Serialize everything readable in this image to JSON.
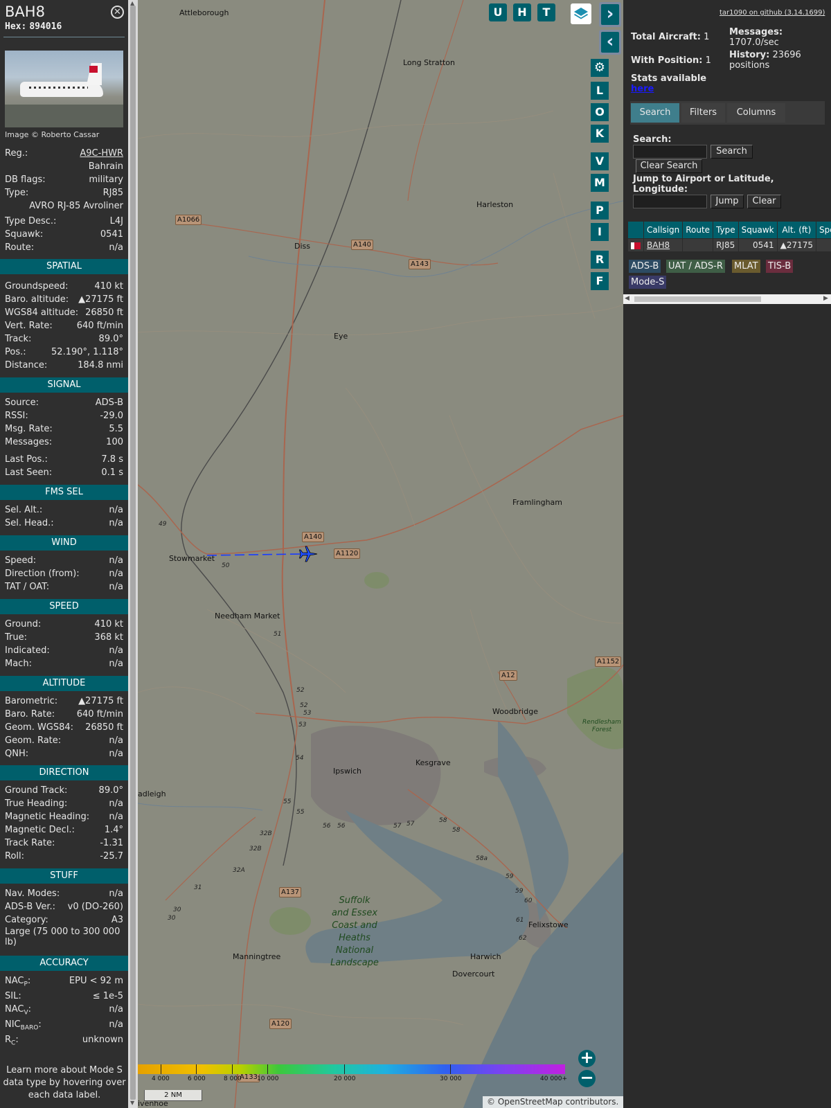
{
  "aircraft": {
    "callsign": "BAH8",
    "hex_label": "Hex:",
    "hex": "894016",
    "image_credit": "Image © Roberto Cassar",
    "fields": {
      "reg_label": "Reg.:",
      "reg": "A9C-HWR",
      "country": "Bahrain",
      "dbflags_label": "DB flags:",
      "dbflags": "military",
      "type_label": "Type:",
      "type": "RJ85",
      "type_name": "AVRO RJ-85 Avroliner",
      "typedesc_label": "Type Desc.:",
      "typedesc": "L4J",
      "squawk_label": "Squawk:",
      "squawk": "0541",
      "route_label": "Route:",
      "route": "n/a"
    }
  },
  "sections": {
    "spatial": {
      "title": "SPATIAL",
      "rows": [
        {
          "l": "Groundspeed:",
          "v": "410 kt"
        },
        {
          "l": "Baro. altitude:",
          "v": "▲27175 ft"
        },
        {
          "l": "WGS84 altitude:",
          "v": "26850 ft"
        },
        {
          "l": "Vert. Rate:",
          "v": "640 ft/min"
        },
        {
          "l": "Track:",
          "v": "89.0°"
        },
        {
          "l": "Pos.:",
          "v": "52.190°, 1.118°"
        },
        {
          "l": "Distance:",
          "v": "184.8 nmi"
        }
      ]
    },
    "signal": {
      "title": "SIGNAL",
      "rows": [
        {
          "l": "Source:",
          "v": "ADS-B"
        },
        {
          "l": "RSSI:",
          "v": "-29.0"
        },
        {
          "l": "Msg. Rate:",
          "v": "5.5"
        },
        {
          "l": "Messages:",
          "v": "100"
        },
        {
          "l": "Last Pos.:",
          "v": "7.8 s"
        },
        {
          "l": "Last Seen:",
          "v": "0.1 s"
        }
      ]
    },
    "fms": {
      "title": "FMS SEL",
      "rows": [
        {
          "l": "Sel. Alt.:",
          "v": "n/a"
        },
        {
          "l": "Sel. Head.:",
          "v": "n/a"
        }
      ]
    },
    "wind": {
      "title": "WIND",
      "rows": [
        {
          "l": "Speed:",
          "v": "n/a"
        },
        {
          "l": "Direction (from):",
          "v": "n/a"
        },
        {
          "l": "TAT / OAT:",
          "v": "n/a"
        }
      ]
    },
    "speed": {
      "title": "SPEED",
      "rows": [
        {
          "l": "Ground:",
          "v": "410 kt"
        },
        {
          "l": "True:",
          "v": "368 kt"
        },
        {
          "l": "Indicated:",
          "v": "n/a"
        },
        {
          "l": "Mach:",
          "v": "n/a"
        }
      ]
    },
    "altitude": {
      "title": "ALTITUDE",
      "rows": [
        {
          "l": "Barometric:",
          "v": "▲27175 ft"
        },
        {
          "l": "Baro. Rate:",
          "v": "640 ft/min"
        },
        {
          "l": "Geom. WGS84:",
          "v": "26850 ft"
        },
        {
          "l": "Geom. Rate:",
          "v": "n/a"
        },
        {
          "l": "QNH:",
          "v": "n/a"
        }
      ]
    },
    "direction": {
      "title": "DIRECTION",
      "rows": [
        {
          "l": "Ground Track:",
          "v": "89.0°"
        },
        {
          "l": "True Heading:",
          "v": "n/a"
        },
        {
          "l": "Magnetic Heading:",
          "v": "n/a"
        },
        {
          "l": "Magnetic Decl.:",
          "v": "1.4°"
        },
        {
          "l": "Track Rate:",
          "v": "-1.31"
        },
        {
          "l": "Roll:",
          "v": "-25.7"
        }
      ]
    },
    "stuff": {
      "title": "STUFF",
      "rows": [
        {
          "l": "Nav. Modes:",
          "v": "n/a"
        },
        {
          "l": "ADS-B Ver.:",
          "v": "v0 (DO-260)"
        },
        {
          "l": "Category:",
          "v": "A3"
        }
      ],
      "category_desc": "Large (75 000 to 300 000 lb)"
    },
    "accuracy": {
      "title": "ACCURACY",
      "rows": [
        {
          "l": "NAC",
          "sub": "P",
          "v": "EPU < 92 m"
        },
        {
          "l": "SIL:",
          "sub": "",
          "v": "≤ 1e-5"
        },
        {
          "l": "NAC",
          "sub": "V",
          "v": "n/a"
        },
        {
          "l": "NIC",
          "sub": "BARO",
          "v": "n/a"
        },
        {
          "l": "R",
          "sub": "C",
          "v": "unknown"
        }
      ]
    }
  },
  "learn_more": "Learn more about Mode S data type by hovering over each data label.",
  "map": {
    "toolbar": {
      "u": "U",
      "h": "H",
      "t": "T"
    },
    "side_buttons": [
      "L",
      "O",
      "K",
      "V",
      "M",
      "P",
      "I",
      "R",
      "F"
    ],
    "places": [
      {
        "name": "Attleborough"
      },
      {
        "name": "Long Stratton"
      },
      {
        "name": "Harleston"
      },
      {
        "name": "Diss"
      },
      {
        "name": "Eye"
      },
      {
        "name": "Framlingham"
      },
      {
        "name": "Stowmarket"
      },
      {
        "name": "Needham Market"
      },
      {
        "name": "Woodbridge"
      },
      {
        "name": "Ipswich"
      },
      {
        "name": "Kesgrave"
      },
      {
        "name": "adleigh"
      },
      {
        "name": "Felixstowe"
      },
      {
        "name": "Manningtree"
      },
      {
        "name": "Harwich"
      },
      {
        "name": "Dovercourt"
      },
      {
        "name": "ivenhoe"
      }
    ],
    "roads": [
      "A1066",
      "A140",
      "A143",
      "A140",
      "A1120",
      "A1152",
      "A12",
      "A137",
      "A120",
      "A133"
    ],
    "junctions": [
      "49",
      "50",
      "51",
      "52",
      "52",
      "53",
      "53",
      "54",
      "55",
      "55",
      "56",
      "56",
      "57",
      "57",
      "58",
      "58",
      "58a",
      "59",
      "59",
      "60",
      "61",
      "62",
      "32B",
      "32B",
      "32A",
      "31",
      "30",
      "30"
    ],
    "aonb_label": [
      "Suffolk",
      "and Essex",
      "Coast and",
      "Heaths",
      "National",
      "Landscape"
    ],
    "forest_label": [
      "Rendlesham",
      "Forest"
    ],
    "altitude_scale": [
      "4 000",
      "6 000",
      "8 000",
      "10 000",
      "20 000",
      "30 000",
      "40 000+"
    ],
    "distance_scale": "2 NM",
    "attribution_prefix": "© ",
    "attribution_link": "OpenStreetMap",
    "attribution_suffix": " contributors."
  },
  "right": {
    "github": "tar1090 on github (3.14.1699)",
    "total_label": "Total Aircraft:",
    "total": "1",
    "messages_label": "Messages:",
    "messages": "1707.0/sec",
    "withpos_label": "With Position:",
    "withpos": "1",
    "history_label": "History:",
    "history": "23696 positions",
    "stats_label": "Stats available",
    "stats_link": "here",
    "tabs": [
      "Search",
      "Filters",
      "Columns"
    ],
    "search_label": "Search:",
    "search_btn": "Search",
    "clear_search_btn": "Clear Search",
    "jump_label": "Jump to Airport or Latitude, Longitude:",
    "jump_btn": "Jump",
    "clear_btn": "Clear",
    "table": {
      "headers": [
        "Callsign",
        "Route",
        "Type",
        "Squawk",
        "Alt. (ft)",
        "Spd"
      ],
      "row": {
        "callsign": "BAH8",
        "route": "",
        "type": "RJ85",
        "squawk": "0541",
        "alt": "▲27175",
        "spd": ""
      }
    },
    "legend": [
      {
        "label": "ADS-B",
        "color": "#2d4b63"
      },
      {
        "label": "UAT / ADS-R",
        "color": "#3f5e46"
      },
      {
        "label": "MLAT",
        "color": "#6a5b2e"
      },
      {
        "label": "TIS-B",
        "color": "#6b2d3e"
      },
      {
        "label": "Mode-S",
        "color": "#393a66"
      }
    ]
  }
}
